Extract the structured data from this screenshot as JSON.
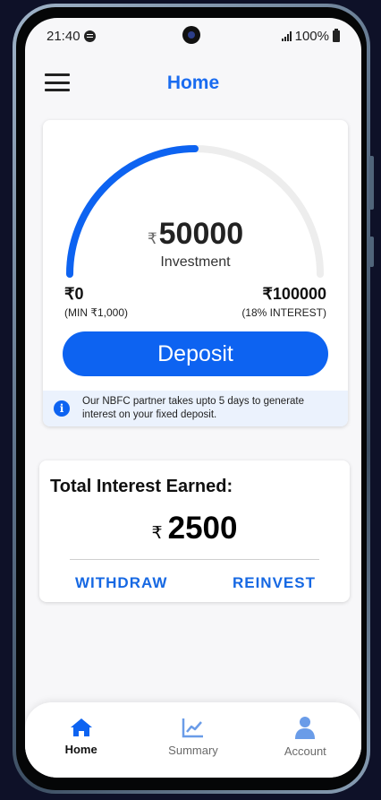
{
  "status_bar": {
    "time": "21:40",
    "battery": "100%"
  },
  "header": {
    "title": "Home"
  },
  "deposit": {
    "amount": "50000",
    "currency_symbol": "₹",
    "amount_label": "Investment",
    "progress_fraction": 0.5,
    "min_value": "₹0",
    "min_note": "(MIN ₹1,000)",
    "max_value": "₹100000",
    "max_note": "(18% INTEREST)",
    "button_label": "Deposit",
    "info_text": "Our NBFC partner takes upto 5 days to generate interest on your fixed deposit."
  },
  "interest": {
    "title": "Total Interest Earned:",
    "currency_symbol": "₹",
    "amount": "2500",
    "withdraw_label": "WITHDRAW",
    "reinvest_label": "REINVEST"
  },
  "bottom_nav": {
    "items": [
      {
        "label": "Home",
        "icon": "home-icon",
        "active": true
      },
      {
        "label": "Summary",
        "icon": "chart-icon",
        "active": false
      },
      {
        "label": "Account",
        "icon": "person-icon",
        "active": false
      }
    ]
  },
  "colors": {
    "accent": "#0d63f1",
    "gauge_track": "#ededed",
    "link": "#1668e3",
    "info_bg": "#ebf2fd",
    "background": "#f7f7f9"
  }
}
